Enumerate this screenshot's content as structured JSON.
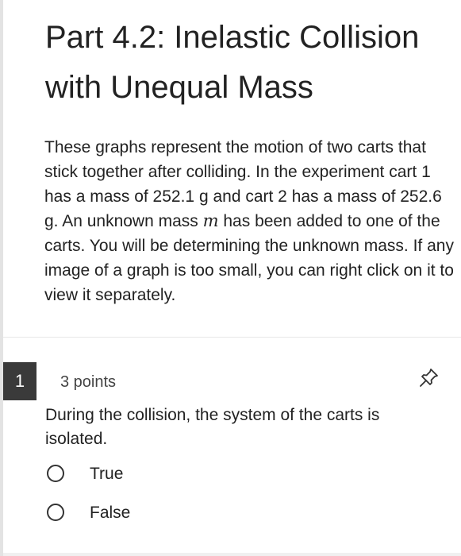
{
  "section": {
    "title": "Part 4.2: Inelastic Collision with Unequal Mass",
    "description_before_var": "These graphs represent the motion of two carts that stick together after colliding. In the experiment cart 1 has a mass of 252.1 g and cart 2 has a mass of 252.6 g. An unknown mass ",
    "variable": "m",
    "description_after_var": " has been added to one of the carts. You will be determining the unknown mass. If any image of a graph is too small, you can right click on it to view it separately."
  },
  "question": {
    "number": "1",
    "points": "3 points",
    "prompt": "During the collision, the system of the carts is isolated.",
    "options": [
      {
        "label": "True",
        "selected": false
      },
      {
        "label": "False",
        "selected": false
      }
    ]
  },
  "icons": {
    "pin": "pin-icon",
    "radio": "radio-circle-icon"
  },
  "colors": {
    "question_number_bg": "#3a3a3a",
    "text": "#222222"
  }
}
